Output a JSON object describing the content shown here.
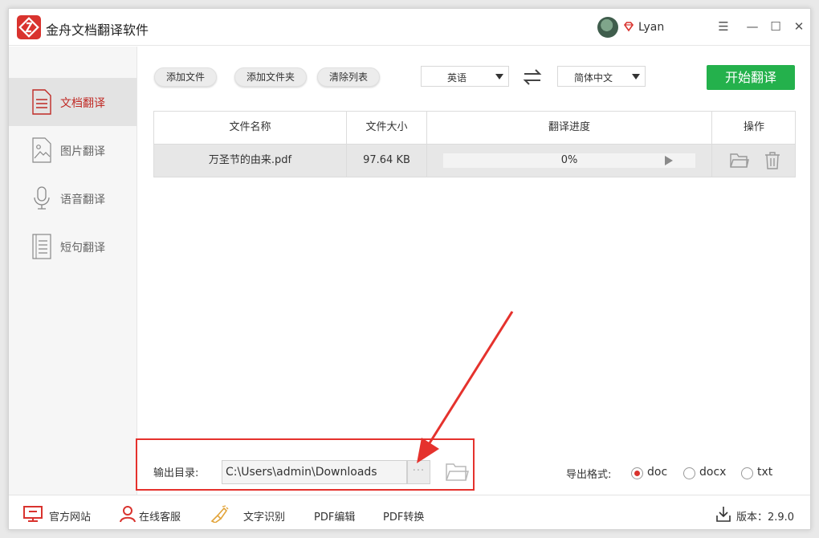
{
  "app": {
    "title": "金舟文档翻译软件",
    "brand_color": "#d9332e",
    "user": {
      "name": "Lyan"
    }
  },
  "window_controls": [
    "menu-icon",
    "minimize-icon",
    "maximize-icon",
    "close-icon"
  ],
  "sidebar": {
    "items": [
      {
        "label": "文档翻译",
        "icon": "document-icon",
        "active": true
      },
      {
        "label": "图片翻译",
        "icon": "image-icon",
        "active": false
      },
      {
        "label": "语音翻译",
        "icon": "microphone-icon",
        "active": false
      },
      {
        "label": "短句翻译",
        "icon": "text-lines-icon",
        "active": false
      }
    ]
  },
  "toolbar": {
    "add_file": "添加文件",
    "add_folder": "添加文件夹",
    "clear_list": "清除列表",
    "source_lang": "英语",
    "target_lang": "简体中文",
    "start": "开始翻译",
    "start_color": "#24b14c"
  },
  "table": {
    "headers": [
      "文件名称",
      "文件大小",
      "翻译进度",
      "操作"
    ],
    "rows": [
      {
        "name": "万圣节的由来.pdf",
        "size": "97.64 KB",
        "progress": 0,
        "progress_text": "0%"
      }
    ]
  },
  "output": {
    "label": "输出目录:",
    "path": "C:\\Users\\admin\\Downloads",
    "browse": "···",
    "format_label": "导出格式:",
    "formats": [
      {
        "label": "doc",
        "checked": true
      },
      {
        "label": "docx",
        "checked": false
      },
      {
        "label": "txt",
        "checked": false
      }
    ]
  },
  "footer": {
    "items": [
      {
        "label": "官方网站",
        "icon": "monitor-icon"
      },
      {
        "label": "在线客服",
        "icon": "person-icon"
      },
      {
        "label": "文字识别",
        "icon": "ocr-icon"
      },
      {
        "label": "PDF编辑",
        "icon": ""
      },
      {
        "label": "PDF转换",
        "icon": ""
      }
    ],
    "version": "版本：2.9.0"
  },
  "annotation_color": "#e5322d"
}
